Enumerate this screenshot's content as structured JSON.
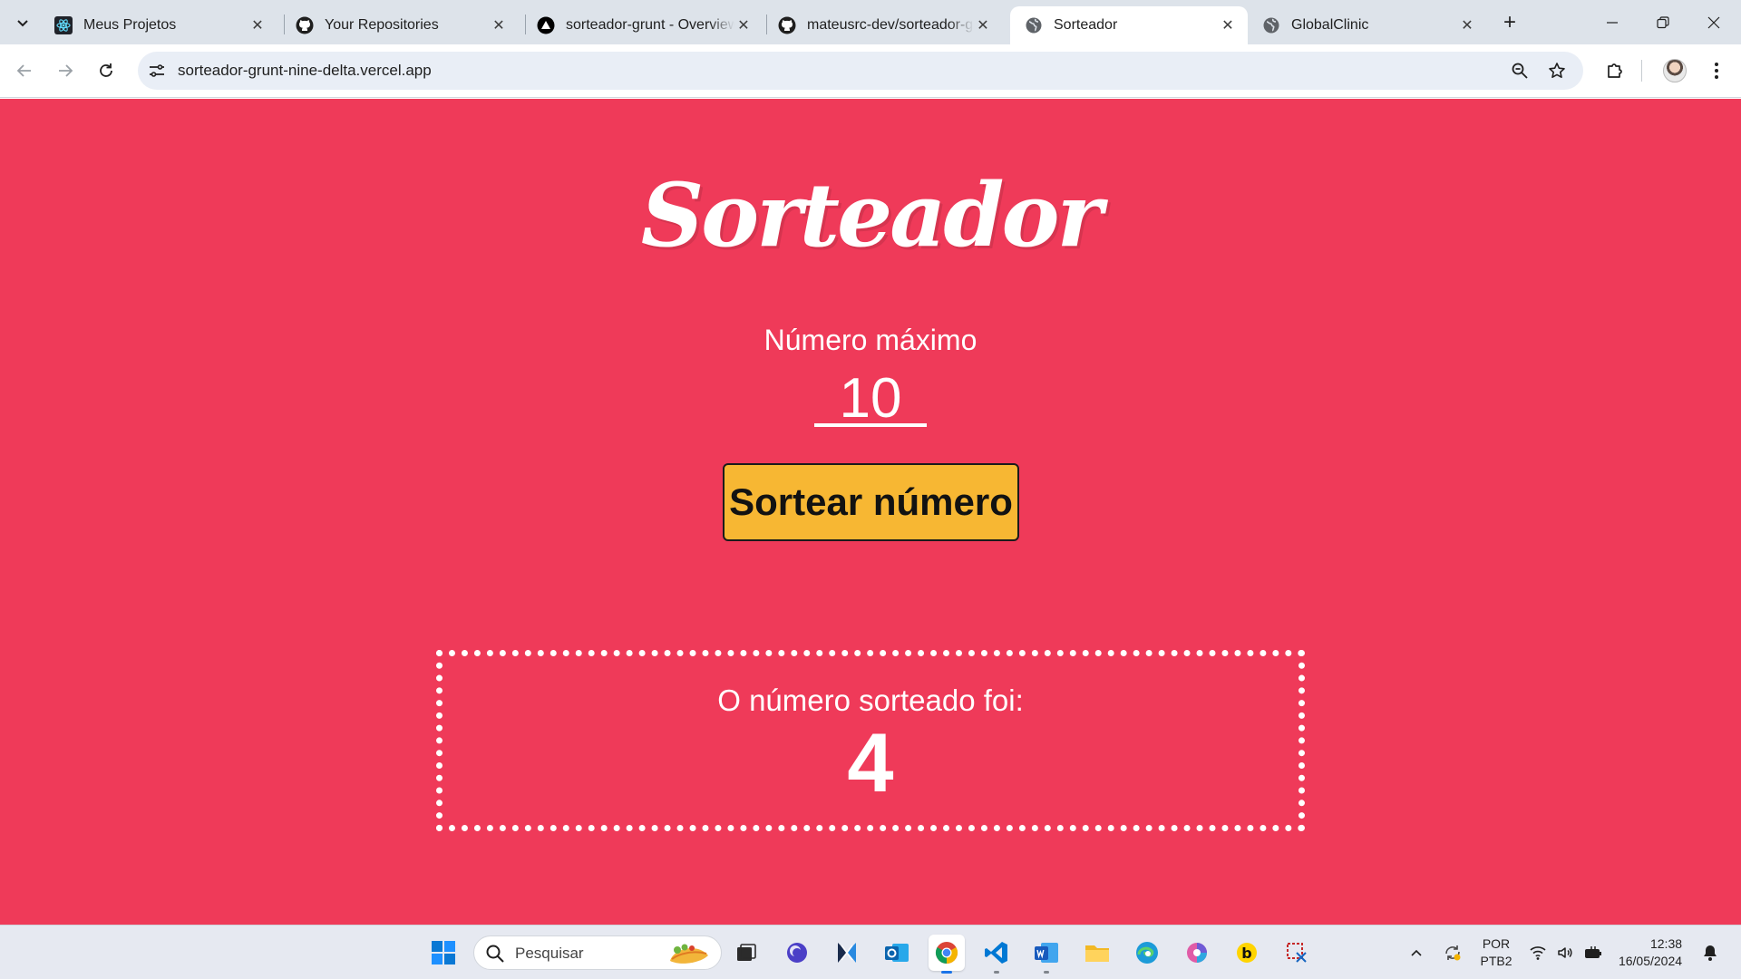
{
  "browser": {
    "tabs": [
      {
        "title": "Meus Projetos",
        "favicon": "react-icon"
      },
      {
        "title": "Your Repositories",
        "favicon": "github-icon"
      },
      {
        "title": "sorteador-grunt - Overview",
        "favicon": "vercel-icon"
      },
      {
        "title": "mateusrc-dev/sorteador-grunt",
        "favicon": "github-icon"
      },
      {
        "title": "Sorteador",
        "favicon": "globe-icon",
        "active": true
      },
      {
        "title": "GlobalClinic",
        "favicon": "globe-icon"
      }
    ],
    "address": "sorteador-grunt-nine-delta.vercel.app"
  },
  "page": {
    "logo": "Sorteador",
    "max_label": "Número máximo",
    "max_value": "10",
    "draw_button": "Sortear número",
    "result_label": "O número sorteado foi:",
    "result_value": "4",
    "colors": {
      "background": "#ef3a59",
      "button": "#f7b733",
      "text": "#ffffff"
    }
  },
  "taskbar": {
    "search_placeholder": "Pesquisar",
    "language_line1": "POR",
    "language_line2": "PTB2",
    "time": "12:38",
    "date": "16/05/2024"
  }
}
